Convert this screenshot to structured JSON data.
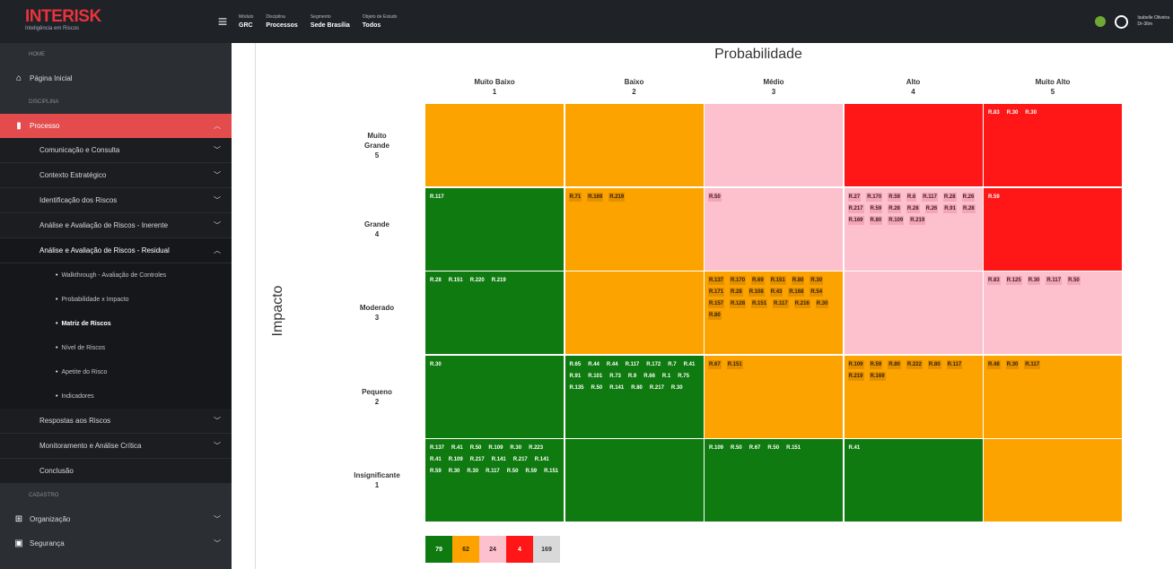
{
  "header": {
    "brand": "INTERISK",
    "tagline": "Inteligência em Riscos",
    "menu_icon": "hamburger-icon",
    "context": [
      {
        "label": "Módulo",
        "value": "GRC"
      },
      {
        "label": "Disciplina",
        "value": "Processos"
      },
      {
        "label": "Segmento",
        "value": "Sede Brasília"
      },
      {
        "label": "Objeto de Estudo",
        "value": "Todos"
      }
    ],
    "user": {
      "name": "Isabelle Oliveira",
      "sub": "Dr-36m"
    }
  },
  "sidebar": {
    "home_section": "HOME",
    "home": "Página Inicial",
    "discipline_section": "DISCIPLINA",
    "process": "Processo",
    "subs": [
      "Comunicação e Consulta",
      "Contexto Estratégico",
      "Identificação dos Riscos",
      "Análise e Avaliação de Riscos - Inerente",
      "Análise e Avaliação de Riscos - Residual"
    ],
    "leaves": [
      "Walkthrough - Avaliação de Controles",
      "Probabilidade x Impacto",
      "Matriz de Riscos",
      "Nível de Riscos",
      "Apetite do Risco",
      "Indicadores"
    ],
    "subs2": [
      "Respostas aos Riscos",
      "Monitoramento e Análise Crítica",
      "Conclusão"
    ],
    "register_section": "CADASTRO",
    "org": "Organização",
    "sec": "Segurança"
  },
  "matrix": {
    "prob_title": "Probabilidade",
    "impact_title": "Impacto",
    "cols": [
      {
        "name": "Muito Baixo",
        "n": "1"
      },
      {
        "name": "Baixo",
        "n": "2"
      },
      {
        "name": "Médio",
        "n": "3"
      },
      {
        "name": "Alto",
        "n": "4"
      },
      {
        "name": "Muito Alto",
        "n": "5"
      }
    ],
    "rows": [
      {
        "name": "Muito Grande",
        "n": "5"
      },
      {
        "name": "Grande",
        "n": "4"
      },
      {
        "name": "Moderado",
        "n": "3"
      },
      {
        "name": "Pequeno",
        "n": "2"
      },
      {
        "name": "Insignificante",
        "n": "1"
      }
    ],
    "cells": [
      [
        {
          "c": "#fda300",
          "t": []
        },
        {
          "c": "#fda300",
          "t": []
        },
        {
          "c": "#fdc0cd",
          "t": []
        },
        {
          "c": "#ff1616",
          "t": []
        },
        {
          "c": "#ff1616",
          "t": [
            "R.83",
            "R.30",
            "R.30"
          ]
        }
      ],
      [
        {
          "c": "#0f7a0f",
          "t": [
            "R.117"
          ]
        },
        {
          "c": "#fda300",
          "t": [
            "R.71",
            "R.169",
            "R.219"
          ]
        },
        {
          "c": "#fdc0cd",
          "t": [
            "R.50"
          ]
        },
        {
          "c": "#fdc0cd",
          "t": [
            "R.27",
            "R.170",
            "R.59",
            "R.6",
            "R.117",
            "R.28",
            "R.26",
            "R.217",
            "R.59",
            "R.28",
            "R.28",
            "R.26",
            "R.91",
            "R.28",
            "R.169",
            "R.80",
            "R.109",
            "R.219"
          ]
        },
        {
          "c": "#ff1616",
          "t": [
            "R.59"
          ]
        }
      ],
      [
        {
          "c": "#0f7a0f",
          "t": [
            "R.28",
            "R.151",
            "R.220",
            "R.219"
          ]
        },
        {
          "c": "#fda300",
          "t": []
        },
        {
          "c": "#fda300",
          "t": [
            "R.137",
            "R.170",
            "R.69",
            "R.151",
            "R.80",
            "R.30",
            "R.171",
            "R.28",
            "R.108",
            "R.43",
            "R.168",
            "R.54",
            "R.157",
            "R.128",
            "R.151",
            "R.117",
            "R.216",
            "R.30",
            "R.80"
          ]
        },
        {
          "c": "#fdc0cd",
          "t": []
        },
        {
          "c": "#fdc0cd",
          "t": [
            "R.83",
            "R.125",
            "R.30",
            "R.117",
            "R.50"
          ]
        }
      ],
      [
        {
          "c": "#0f7a0f",
          "t": [
            "R.30"
          ]
        },
        {
          "c": "#0f7a0f",
          "t": [
            "R.65",
            "R.44",
            "R.44",
            "R.117",
            "R.172",
            "R.7",
            "R.41",
            "R.91",
            "R.101",
            "R.73",
            "R.9",
            "R.66",
            "R.1",
            "R.75",
            "R.135",
            "R.50",
            "R.141",
            "R.80",
            "R.217",
            "R.30"
          ]
        },
        {
          "c": "#fda300",
          "t": [
            "R.67",
            "R.151"
          ]
        },
        {
          "c": "#fda300",
          "t": [
            "R.109",
            "R.59",
            "R.80",
            "R.222",
            "R.80",
            "R.117",
            "R.219",
            "R.169"
          ]
        },
        {
          "c": "#fda300",
          "t": [
            "R.48",
            "R.30",
            "R.117"
          ]
        }
      ],
      [
        {
          "c": "#0f7a0f",
          "t": [
            "R.137",
            "R.41",
            "R.50",
            "R.109",
            "R.30",
            "R.223",
            "R.41",
            "R.109",
            "R.217",
            "R.141",
            "R.217",
            "R.141",
            "R.59",
            "R.30",
            "R.30",
            "R.117",
            "R.50",
            "R.59",
            "R.151"
          ]
        },
        {
          "c": "#0f7a0f",
          "t": []
        },
        {
          "c": "#0f7a0f",
          "t": [
            "R.109",
            "R.50",
            "R.67",
            "R.50",
            "R.151"
          ]
        },
        {
          "c": "#0f7a0f",
          "t": [
            "R.41"
          ]
        },
        {
          "c": "#fda300",
          "t": []
        }
      ]
    ]
  },
  "legend": [
    {
      "v": "79",
      "c": "#0f7a0f",
      "fg": "#ffffff"
    },
    {
      "v": "62",
      "c": "#fda300",
      "fg": "#3a2400"
    },
    {
      "v": "24",
      "c": "#fdc0cd",
      "fg": "#3a1d24"
    },
    {
      "v": "4",
      "c": "#ff1616",
      "fg": "#ffffff"
    },
    {
      "v": "169",
      "c": "#d9d9d9",
      "fg": "#333333"
    }
  ]
}
